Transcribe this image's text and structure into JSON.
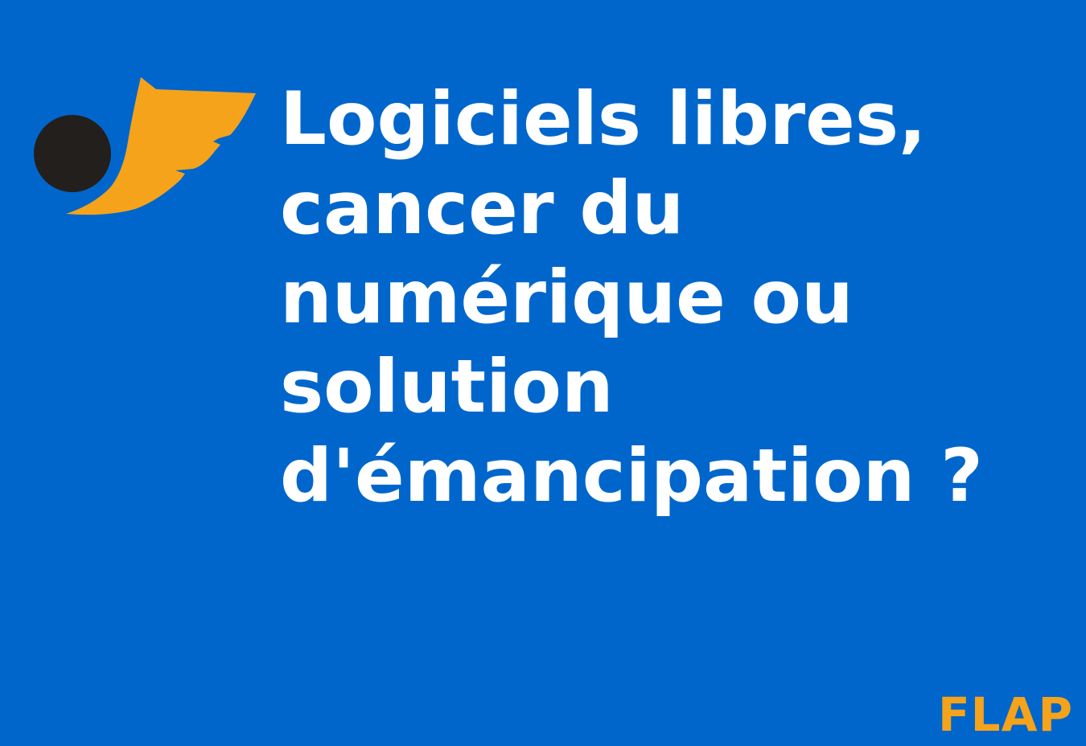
{
  "logo": {
    "icon": "winged-ball-logo",
    "wing_color": "#f5a31a",
    "ball_color": "#231f1c"
  },
  "title": {
    "lines": [
      "Logiciels libres,",
      "cancer du",
      "numérique ou",
      "solution",
      "d'émancipation ?"
    ]
  },
  "brand": {
    "label": "FLAP"
  },
  "colors": {
    "background": "#0066cc",
    "title": "#ffffff",
    "brand": "#f5a31a"
  }
}
